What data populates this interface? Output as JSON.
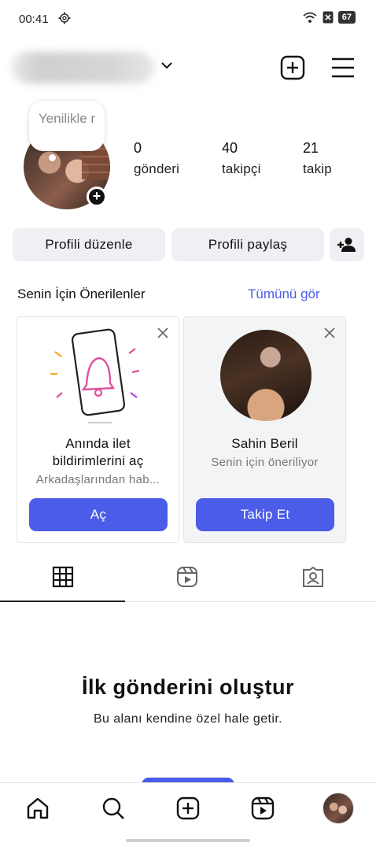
{
  "status_bar": {
    "time": "00:41",
    "battery": "67"
  },
  "profile": {
    "note": "Yenilikle r",
    "stats": [
      {
        "value": "0",
        "label": "gönderi"
      },
      {
        "value": "40",
        "label": "takipçi"
      },
      {
        "value": "21",
        "label": "takip"
      }
    ]
  },
  "actions": {
    "edit_profile": "Profili düzenle",
    "share_profile": "Profili paylaş"
  },
  "suggestions": {
    "title": "Senin İçin Önerilenler",
    "see_all": "Tümünü gör",
    "cards": [
      {
        "title_line1": "Anında ilet",
        "title_line2": "bildirimlerini aç",
        "subtitle": "Arkadaşlarından hab...",
        "button": "Aç"
      },
      {
        "title_line1": "Sahin Beril",
        "subtitle": "Senin için öneriliyor",
        "button": "Takip Et"
      }
    ]
  },
  "tabs": [
    "grid-icon",
    "reels-icon",
    "tagged-icon"
  ],
  "empty_state": {
    "title": "İlk gönderini oluştur",
    "subtitle": "Bu alanı kendine özel hale getir."
  },
  "bottom_nav": [
    "home-icon",
    "search-icon",
    "create-icon",
    "reels-icon",
    "profile-avatar"
  ],
  "colors": {
    "accent": "#4a5ce8",
    "button_gray": "#eef0f3"
  }
}
